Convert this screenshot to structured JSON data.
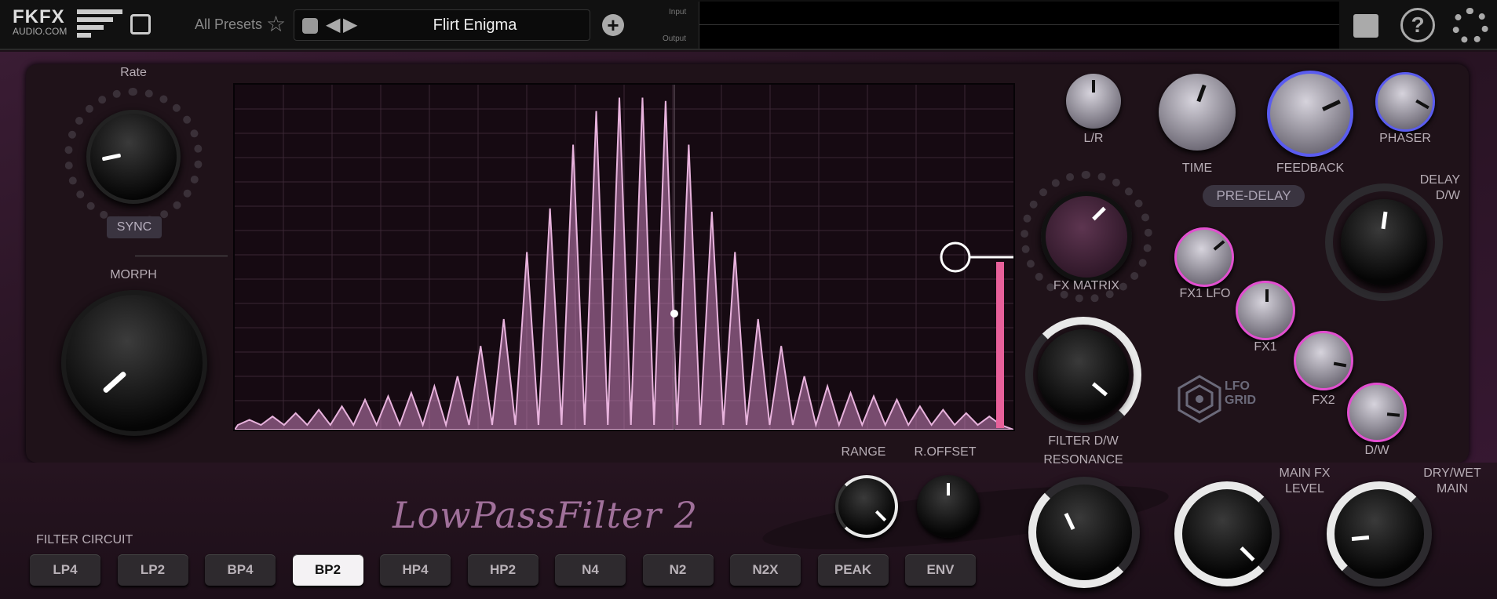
{
  "brand": {
    "line1": "FKFX",
    "line2": "AUDIO.COM"
  },
  "presets": {
    "all_label": "All Presets",
    "name": "Flirt Enigma",
    "io_in": "Input",
    "io_out": "Output"
  },
  "knobs": {
    "rate": "Rate",
    "sync": "SYNC",
    "morph": "MORPH",
    "lr": "L/R",
    "time": "TIME",
    "feedback": "FEEDBACK",
    "phaser": "PHASER",
    "pre_delay": "PRE-DELAY",
    "delay_dw": "DELAY\nD/W",
    "fx_matrix": "FX MATRIX",
    "fx1_lfo": "FX1 LFO",
    "fx1": "FX1",
    "fx2": "FX2",
    "dw": "D/W",
    "filter_dw": "FILTER D/W",
    "resonance": "RESONANCE",
    "range": "RANGE",
    "roffset": "R.OFFSET",
    "main_fx": "MAIN FX\nLEVEL",
    "drywet": "DRY/WET\nMAIN"
  },
  "logo_text": "LFO\nGRID",
  "title": "LowPassFilter 2",
  "filter_circuit": {
    "label": "FILTER CIRCUIT",
    "buttons": [
      "LP4",
      "LP2",
      "BP4",
      "BP2",
      "HP4",
      "HP2",
      "N4",
      "N2",
      "N2X",
      "PEAK",
      "ENV"
    ],
    "active": "BP2"
  },
  "colors": {
    "accent": "#e24fd0",
    "blue": "#5a5cf0",
    "bg": "#1c1018",
    "spectrum": "#e8b3dd"
  },
  "spectrum_peaks": [
    0.02,
    0.03,
    0.04,
    0.05,
    0.06,
    0.08,
    0.09,
    0.1,
    0.12,
    0.15,
    0.24,
    0.32,
    0.52,
    0.65,
    0.84,
    0.94,
    0.98,
    0.98,
    0.97,
    0.84,
    0.64,
    0.52,
    0.32,
    0.24,
    0.15,
    0.12,
    0.1,
    0.09,
    0.08,
    0.06,
    0.05,
    0.04,
    0.03
  ]
}
